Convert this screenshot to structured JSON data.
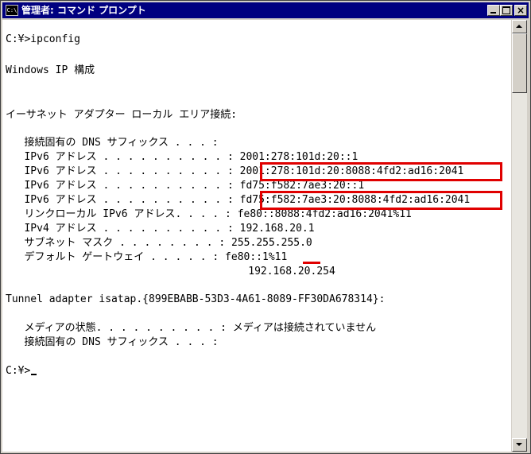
{
  "window": {
    "title": "管理者: コマンド プロンプト",
    "app_icon_text": "C:\\",
    "buttons": {
      "minimize": "minimize-icon",
      "maximize": "maximize-icon",
      "close": "close-icon",
      "close_glyph": "×"
    }
  },
  "console": {
    "lines": [
      "C:¥>ipconfig",
      "Windows IP 構成",
      "イーサネット アダプター ローカル エリア接続:",
      "   接続固有の DNS サフィックス . . . :",
      "   IPv6 アドレス . . . . . . . . . . : 2001:278:101d:20::1",
      "   IPv6 アドレス . . . . . . . . . . : 2001:278:101d:20:8088:4fd2:ad16:2041",
      "   IPv6 アドレス . . . . . . . . . . : fd75:f582:7ae3:20::1",
      "   IPv6 アドレス . . . . . . . . . . : fd75:f582:7ae3:20:8088:4fd2:ad16:2041",
      "   リンクローカル IPv6 アドレス. . . . : fe80::8088:4fd2:ad16:2041%11",
      "   IPv4 アドレス . . . . . . . . . . : 192.168.20.1",
      "   サブネット マスク . . . . . . . . : 255.255.255.0",
      "   デフォルト ゲートウェイ . . . . . : fe80::1%11",
      "                                       192.168.20.254",
      "Tunnel adapter isatap.{899EBABB-53D3-4A61-8089-FF30DA678314}:",
      "   メディアの状態. . . . . . . . . . : メディアは接続されていません",
      "   接続固有の DNS サフィックス . . . :",
      "C:¥>"
    ]
  },
  "colors": {
    "titlebar": "#000080",
    "highlight": "#e00000",
    "console_bg": "#ffffff",
    "console_text": "#000000"
  }
}
